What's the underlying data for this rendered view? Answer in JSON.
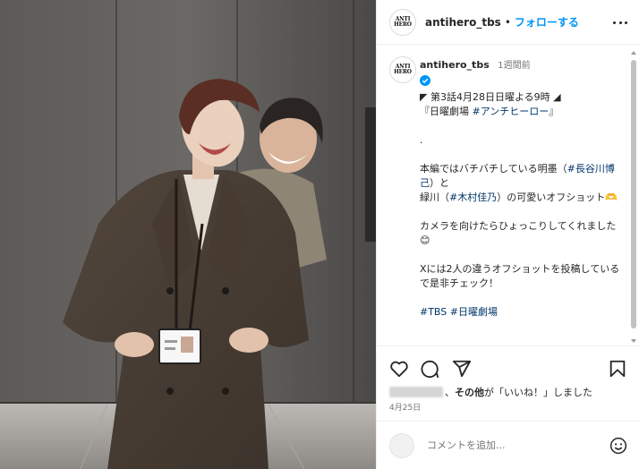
{
  "header": {
    "logo_text": "ANTI HERO",
    "username": "antihero_tbs",
    "separator": "•",
    "follow_label": "フォローする",
    "more_icon": "more-horizontal-icon"
  },
  "caption": {
    "username": "antihero_tbs",
    "time_ago": "1週間前",
    "verified_icon": "verified-badge-icon",
    "lines": [
      "◤ 第3話4月28日日曜よる9時 ◢",
      "『日曜劇場 #アンチヒーロー』",
      "",
      "．",
      "",
      "本編ではバチバチしている明墨（#長谷川博己）と",
      "緑川（#木村佳乃）の可愛いオフショット🫶",
      "",
      "カメラを向けたらひょっこりしてくれました😊",
      "",
      "Xには2人の違うオフショットを投稿しているで是非チェック！",
      "",
      "#TBS #日曜劇場"
    ],
    "line1": "◤ 第3話4月28日日曜よる9時 ◢",
    "line2_pre": "『日曜劇場 ",
    "line2_tag": "#アンチヒーロー",
    "line2_post": "』",
    "line3": ".",
    "line4_pre": "本編ではバチバチしている明墨（",
    "line4_tag": "#長谷川博己",
    "line4_post": "）と",
    "line5_pre": "緑川（",
    "line5_tag": "#木村佳乃",
    "line5_post": "）の可愛いオフショット🫶",
    "line6": "カメラを向けたらひょっこりしてくれました😊",
    "line7": "Xには2人の違うオフショットを投稿しているで是非チェック！",
    "tags": "#TBS #日曜劇場"
  },
  "actions": {
    "like_icon": "heart-icon",
    "comment_icon": "comment-icon",
    "share_icon": "share-icon",
    "save_icon": "bookmark-icon"
  },
  "likes": {
    "text_bold": "その他",
    "text_suffix": "が「いいね！」しました",
    "prefix": "、"
  },
  "date": "4月25日",
  "comment": {
    "placeholder": "コメントを追加...",
    "emoji_icon": "emoji-icon"
  },
  "colors": {
    "accent": "#0095f6",
    "text": "#262626",
    "muted": "#737373",
    "hashtag": "#00376b"
  }
}
